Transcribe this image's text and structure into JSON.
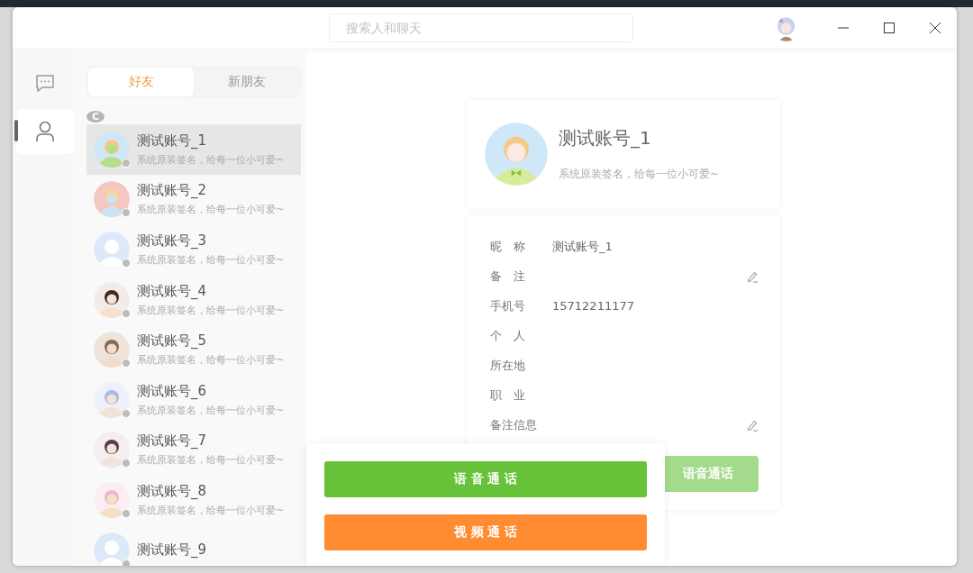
{
  "search": {
    "placeholder": "搜索人和聊天"
  },
  "rail": [
    {
      "kind": "chat",
      "selected": false
    },
    {
      "kind": "contacts",
      "selected": true
    }
  ],
  "tabs": [
    {
      "label": "好友",
      "selected": true
    },
    {
      "label": "新朋友",
      "selected": false
    }
  ],
  "section_letter": "C",
  "contacts": [
    {
      "name": "测试账号_1",
      "signature": "系统原装签名，给每一位小可爱~",
      "online": false,
      "selected": true
    },
    {
      "name": "测试账号_2",
      "signature": "系统原装签名，给每一位小可爱~",
      "online": false,
      "selected": false
    },
    {
      "name": "测试账号_3",
      "signature": "系统原装签名，给每一位小可爱~",
      "online": false,
      "selected": false
    },
    {
      "name": "测试账号_4",
      "signature": "系统原装签名，给每一位小可爱~",
      "online": false,
      "selected": false
    },
    {
      "name": "测试账号_5",
      "signature": "系统原装签名，给每一位小可爱~",
      "online": false,
      "selected": false
    },
    {
      "name": "测试账号_6",
      "signature": "系统原装签名，给每一位小可爱~",
      "online": false,
      "selected": false
    },
    {
      "name": "测试账号_7",
      "signature": "系统原装签名，给每一位小可爱~",
      "online": false,
      "selected": false
    },
    {
      "name": "测试账号_8",
      "signature": "系统原装签名，给每一位小可爱~",
      "online": false,
      "selected": false
    },
    {
      "name": "测试账号_9",
      "online": false,
      "selected": false
    }
  ],
  "profile": {
    "name": "测试账号_1",
    "signature": "系统原装签名，给每一位小可爱~"
  },
  "info_rows": [
    {
      "label": "昵　称",
      "value": "测试账号_1",
      "editable": false
    },
    {
      "label": "备　注",
      "editable": true
    },
    {
      "label": "手机号",
      "value": "15712211177",
      "editable": false
    },
    {
      "label": "个　人",
      "editable": false
    },
    {
      "label": "所在地",
      "editable": false
    },
    {
      "label": "职　业",
      "editable": false
    },
    {
      "label": "备注信息",
      "editable": true
    }
  ],
  "card_button": "语音通话",
  "popup": {
    "buttons": [
      {
        "label": "语 音 通 话",
        "kind": "voice"
      },
      {
        "label": "视 频 通 话",
        "kind": "video"
      }
    ]
  }
}
